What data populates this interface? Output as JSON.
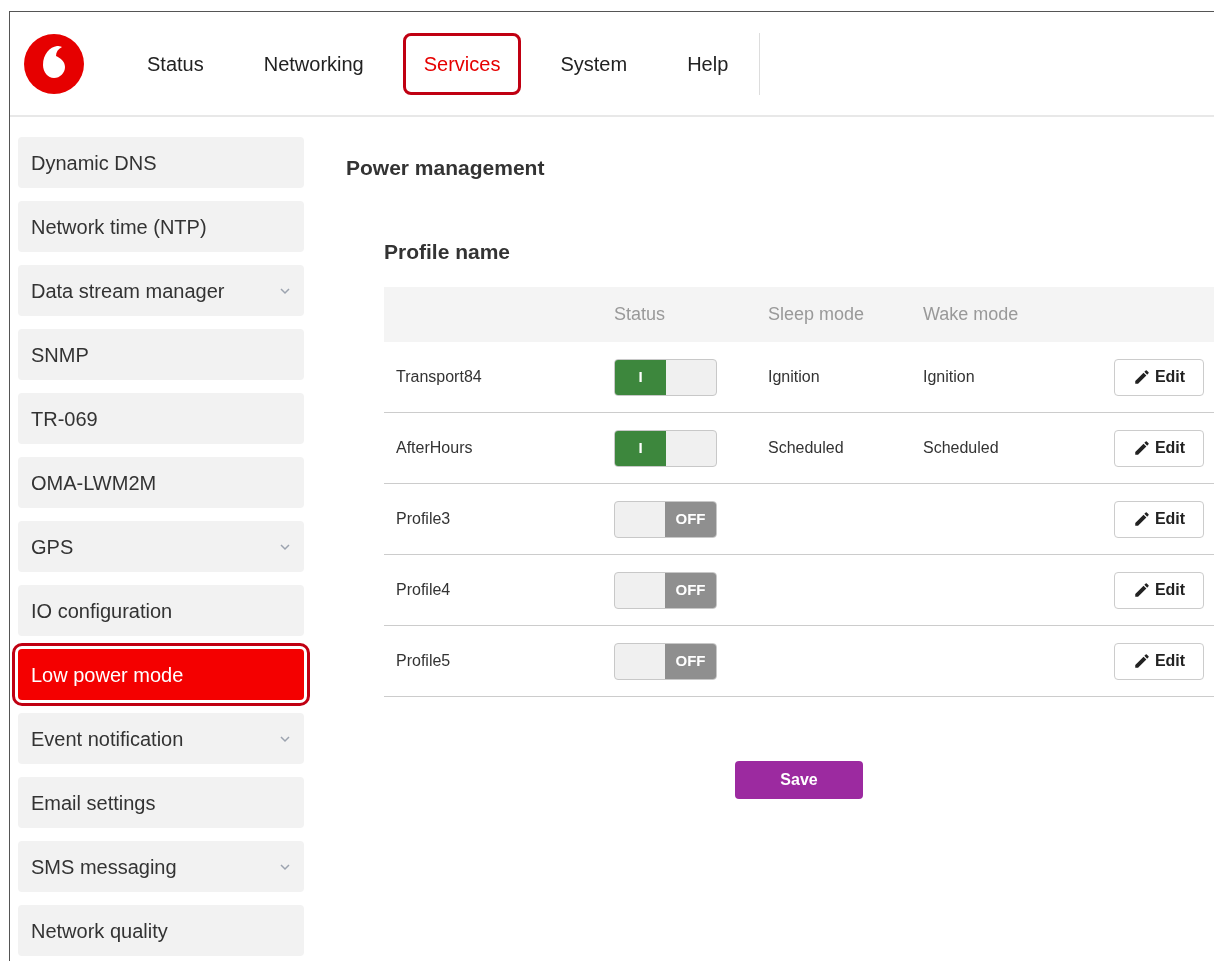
{
  "nav": {
    "items": [
      {
        "label": "Status",
        "selected": false
      },
      {
        "label": "Networking",
        "selected": false
      },
      {
        "label": "Services",
        "selected": true
      },
      {
        "label": "System",
        "selected": false
      },
      {
        "label": "Help",
        "selected": false
      }
    ]
  },
  "sidebar": {
    "items": [
      {
        "label": "Dynamic DNS",
        "expandable": false,
        "selected": false
      },
      {
        "label": "Network time (NTP)",
        "expandable": false,
        "selected": false
      },
      {
        "label": "Data stream manager",
        "expandable": true,
        "selected": false
      },
      {
        "label": "SNMP",
        "expandable": false,
        "selected": false
      },
      {
        "label": "TR-069",
        "expandable": false,
        "selected": false
      },
      {
        "label": "OMA-LWM2M",
        "expandable": false,
        "selected": false
      },
      {
        "label": "GPS",
        "expandable": true,
        "selected": false
      },
      {
        "label": "IO configuration",
        "expandable": false,
        "selected": false
      },
      {
        "label": "Low power mode",
        "expandable": false,
        "selected": true
      },
      {
        "label": "Event notification",
        "expandable": true,
        "selected": false
      },
      {
        "label": "Email settings",
        "expandable": false,
        "selected": false
      },
      {
        "label": "SMS messaging",
        "expandable": true,
        "selected": false
      },
      {
        "label": "Network quality",
        "expandable": false,
        "selected": false
      }
    ]
  },
  "page_title": "Power management",
  "section_title": "Profile name",
  "table": {
    "columns": [
      "Status",
      "Sleep mode",
      "Wake mode"
    ],
    "rows": [
      {
        "name": "Transport84",
        "on": true,
        "switch_label": "I",
        "sleep_mode": "Ignition",
        "wake_mode": "Ignition",
        "action": "Edit"
      },
      {
        "name": "AfterHours",
        "on": true,
        "switch_label": "I",
        "sleep_mode": "Scheduled",
        "wake_mode": "Scheduled",
        "action": "Edit"
      },
      {
        "name": "Profile3",
        "on": false,
        "switch_label": "OFF",
        "action": "Edit"
      },
      {
        "name": "Profile4",
        "on": false,
        "switch_label": "OFF",
        "action": "Edit"
      },
      {
        "name": "Profile5",
        "on": false,
        "switch_label": "OFF",
        "action": "Edit"
      }
    ]
  },
  "save_button": "Save"
}
